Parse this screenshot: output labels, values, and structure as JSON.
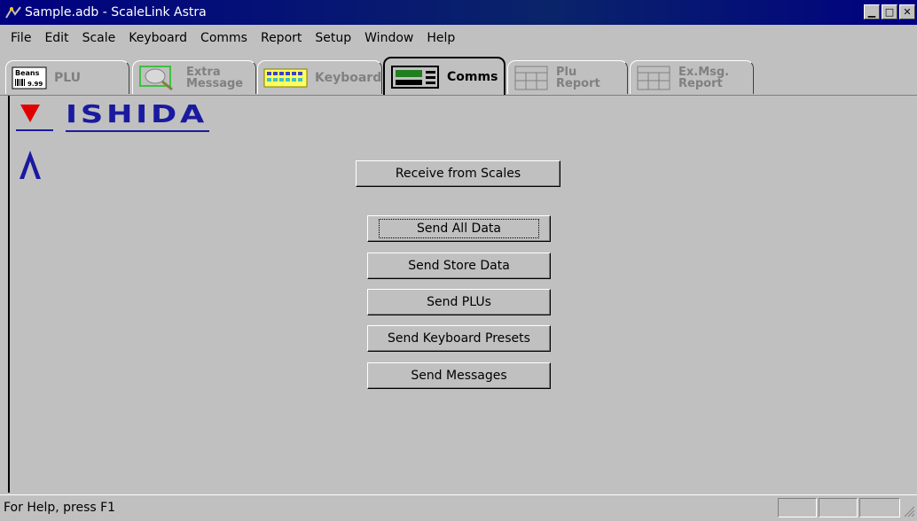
{
  "window": {
    "title": "Sample.adb - ScaleLink Astra"
  },
  "menu": [
    "File",
    "Edit",
    "Scale",
    "Keyboard",
    "Comms",
    "Report",
    "Setup",
    "Window",
    "Help"
  ],
  "tabs": {
    "plu": "PLU",
    "plu_icon_text_1": "Beans",
    "plu_icon_text_2": "9.99",
    "extra_1": "Extra",
    "extra_2": "Message",
    "keyboard": "Keyboard",
    "comms": "Comms",
    "plu_report_1": "Plu",
    "plu_report_2": "Report",
    "exmsg_report_1": "Ex.Msg.",
    "exmsg_report_2": "Report"
  },
  "logo": {
    "text": "ISHIDA"
  },
  "buttons": {
    "receive": "Receive from Scales",
    "send_all": "Send All Data",
    "send_store": "Send Store Data",
    "send_plus": "Send PLUs",
    "send_keyboard": "Send Keyboard Presets",
    "send_messages": "Send Messages"
  },
  "status": {
    "text": "For Help, press F1"
  },
  "colors": {
    "title_bg": "#000080",
    "logo_blue": "#1a1aa0",
    "logo_red": "#e00000",
    "face": "#c0c0c0"
  }
}
